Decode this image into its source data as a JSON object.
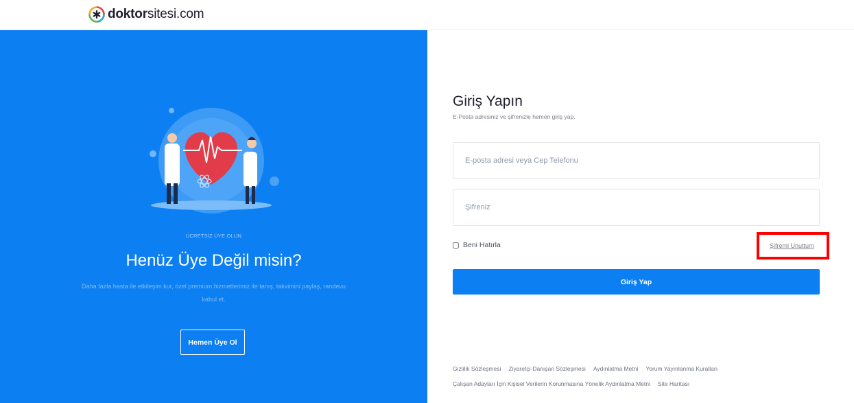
{
  "brand": {
    "name_bold": "doktor",
    "name_rest": "sitesi.com",
    "colors": {
      "primary": "#0c7ff2",
      "highlight_border": "#ff0000"
    }
  },
  "promo": {
    "eyebrow": "ÜCRETSİZ ÜYE OLUN",
    "title": "Henüz Üye Değil misin?",
    "description": "Daha fazla hasta ile etkileşim kur, özel premium hizmetlerimiz ile tanış, takvimini paylaş, randevu kabul et.",
    "button_label": "Hemen Üye Ol",
    "illustration": "doctors-holding-heart-illustration"
  },
  "login": {
    "title": "Giriş Yapın",
    "subtitle": "E-Posta adresiniz ve şifrenizle hemen giriş yap.",
    "email_placeholder": "E-posta adresi veya Cep Telefonu",
    "password_placeholder": "Şifreniz",
    "remember_label": "Beni Hatırla",
    "forgot_label": "Şifremi Unuttum",
    "submit_label": "Giriş Yap"
  },
  "footer": {
    "links": [
      "Gizlilik Sözleşmesi",
      "Ziyaretçi-Danışan Sözleşmesi",
      "Aydınlatma Metni",
      "Yorum Yayınlanma Kuralları",
      "Çalışan Adayları İçin Kişisel Verilerin Korunmasına Yönelik Aydınlatma Metni",
      "Site Haritası"
    ]
  }
}
